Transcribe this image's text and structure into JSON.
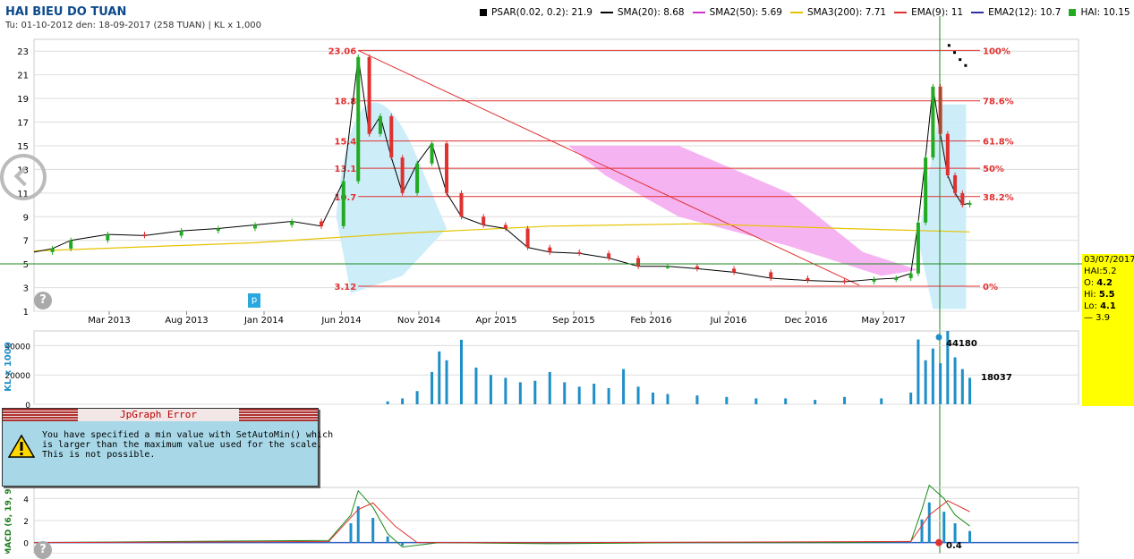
{
  "header": {
    "title": "HAI BIEU DO TUAN",
    "subtitle": "Tu: 01-10-2012 den: 18-09-2017 (258 TUAN) | KL x 1,000"
  },
  "legend": [
    {
      "label": "PSAR(0.02, 0.2): 21.9",
      "color": "#000000",
      "shape": "square"
    },
    {
      "label": "SMA(20): 8.68",
      "color": "#000000",
      "shape": "line"
    },
    {
      "label": "SMA2(50): 5.69",
      "color": "#cc33cc",
      "shape": "line"
    },
    {
      "label": "SMA3(200): 7.71",
      "color": "#e6c300",
      "shape": "line"
    },
    {
      "label": "EMA(9): 11",
      "color": "#e03030",
      "shape": "line"
    },
    {
      "label": "EMA2(12): 10.7",
      "color": "#3030a0",
      "shape": "line"
    },
    {
      "label": "HAI: 10.15",
      "color": "#22aa22",
      "shape": "square"
    }
  ],
  "info_box": {
    "date": "03/07/2017",
    "hai": "HAI:5.2",
    "o_label": "O:",
    "o_value": "4.2",
    "hi_label": "Hi:",
    "hi_value": "5.5",
    "lo_label": "Lo:",
    "lo_value": "4.1",
    "last": "— 3.9"
  },
  "error_box": {
    "title": "JpGraph Error",
    "message": "You have specified a min value with SetAutoMin() which\nis larger than the maximum value used for the scale.\nThis is not possible."
  },
  "markers": {
    "p_label": "p",
    "help_glyph": "?"
  },
  "colors": {
    "up": "#22aa22",
    "down": "#e03030",
    "cloud_blue": "#c8ecf8",
    "cloud_pink": "#f4a6f0",
    "volume_bar": "#1f8fc8",
    "fib_line": "#e03030",
    "grid": "#dddddd"
  },
  "chart_data": [
    {
      "type": "candlestick",
      "name": "price",
      "ylim": [
        1,
        24
      ],
      "yticks": [
        1,
        3,
        5,
        7,
        9,
        11,
        13,
        15,
        17,
        19,
        21,
        23
      ],
      "xticks": [
        "Mar 2013",
        "Aug 2013",
        "Jan 2014",
        "Jun 2014",
        "Nov 2014",
        "Apr 2015",
        "Sep 2015",
        "Feb 2016",
        "Jul 2016",
        "Dec 2016",
        "May 2017"
      ],
      "fibonacci": [
        {
          "label": "100%",
          "value": 23.06
        },
        {
          "label": "78.6%",
          "value": 18.8
        },
        {
          "label": "61.8%",
          "value": 15.4
        },
        {
          "label": "50%",
          "value": 13.1
        },
        {
          "label": "38.2%",
          "value": 10.7
        },
        {
          "label": "0%",
          "value": 3.12
        }
      ],
      "level_labels": [
        "23.06",
        "18.8",
        "15.4",
        "13.1",
        "10.7",
        "3.12"
      ],
      "close_series": [
        {
          "t": 0,
          "v": 6.0
        },
        {
          "t": 5,
          "v": 6.3
        },
        {
          "t": 10,
          "v": 7.0
        },
        {
          "t": 20,
          "v": 7.5
        },
        {
          "t": 30,
          "v": 7.4
        },
        {
          "t": 40,
          "v": 7.8
        },
        {
          "t": 50,
          "v": 8.0
        },
        {
          "t": 60,
          "v": 8.3
        },
        {
          "t": 70,
          "v": 8.6
        },
        {
          "t": 78,
          "v": 8.2
        },
        {
          "t": 84,
          "v": 12.0
        },
        {
          "t": 88,
          "v": 22.5
        },
        {
          "t": 91,
          "v": 16.0
        },
        {
          "t": 94,
          "v": 17.5
        },
        {
          "t": 97,
          "v": 14.0
        },
        {
          "t": 100,
          "v": 11.0
        },
        {
          "t": 104,
          "v": 13.5
        },
        {
          "t": 108,
          "v": 15.2
        },
        {
          "t": 112,
          "v": 11.0
        },
        {
          "t": 116,
          "v": 9.0
        },
        {
          "t": 122,
          "v": 8.3
        },
        {
          "t": 128,
          "v": 8.0
        },
        {
          "t": 134,
          "v": 6.4
        },
        {
          "t": 140,
          "v": 6.0
        },
        {
          "t": 148,
          "v": 5.9
        },
        {
          "t": 156,
          "v": 5.5
        },
        {
          "t": 164,
          "v": 4.8
        },
        {
          "t": 172,
          "v": 4.8
        },
        {
          "t": 180,
          "v": 4.6
        },
        {
          "t": 190,
          "v": 4.3
        },
        {
          "t": 200,
          "v": 3.8
        },
        {
          "t": 210,
          "v": 3.6
        },
        {
          "t": 220,
          "v": 3.5
        },
        {
          "t": 228,
          "v": 3.7
        },
        {
          "t": 234,
          "v": 3.8
        },
        {
          "t": 238,
          "v": 4.2
        },
        {
          "t": 240,
          "v": 8.5
        },
        {
          "t": 242,
          "v": 14.0
        },
        {
          "t": 244,
          "v": 20.0
        },
        {
          "t": 246,
          "v": 16.0
        },
        {
          "t": 248,
          "v": 12.5
        },
        {
          "t": 250,
          "v": 11.0
        },
        {
          "t": 252,
          "v": 10.0
        },
        {
          "t": 254,
          "v": 10.15
        }
      ],
      "sma200_series": [
        {
          "t": 0,
          "v": 6.1
        },
        {
          "t": 60,
          "v": 6.8
        },
        {
          "t": 100,
          "v": 7.6
        },
        {
          "t": 140,
          "v": 8.2
        },
        {
          "t": 180,
          "v": 8.4
        },
        {
          "t": 220,
          "v": 8.0
        },
        {
          "t": 254,
          "v": 7.71
        }
      ],
      "psar_recent": [
        23.6,
        23.0,
        22.4,
        21.9
      ]
    },
    {
      "type": "bar",
      "name": "volume",
      "ylabel": "KL x 1000",
      "ylim": [
        0,
        50000
      ],
      "yticks": [
        0,
        20000,
        40000
      ],
      "labels": {
        "peak": "44180",
        "last": "18037"
      },
      "values": [
        {
          "t": 96,
          "v": 2000
        },
        {
          "t": 100,
          "v": 4000
        },
        {
          "t": 104,
          "v": 9000
        },
        {
          "t": 108,
          "v": 22000
        },
        {
          "t": 110,
          "v": 36000
        },
        {
          "t": 112,
          "v": 30000
        },
        {
          "t": 116,
          "v": 44000
        },
        {
          "t": 120,
          "v": 25000
        },
        {
          "t": 124,
          "v": 20000
        },
        {
          "t": 128,
          "v": 18000
        },
        {
          "t": 132,
          "v": 15000
        },
        {
          "t": 136,
          "v": 16000
        },
        {
          "t": 140,
          "v": 22000
        },
        {
          "t": 144,
          "v": 15000
        },
        {
          "t": 148,
          "v": 12000
        },
        {
          "t": 152,
          "v": 14000
        },
        {
          "t": 156,
          "v": 11000
        },
        {
          "t": 160,
          "v": 24000
        },
        {
          "t": 164,
          "v": 12000
        },
        {
          "t": 168,
          "v": 8000
        },
        {
          "t": 172,
          "v": 7000
        },
        {
          "t": 180,
          "v": 6000
        },
        {
          "t": 188,
          "v": 5000
        },
        {
          "t": 196,
          "v": 4000
        },
        {
          "t": 204,
          "v": 4000
        },
        {
          "t": 212,
          "v": 3000
        },
        {
          "t": 220,
          "v": 5000
        },
        {
          "t": 230,
          "v": 4000
        },
        {
          "t": 238,
          "v": 8000
        },
        {
          "t": 240,
          "v": 44180
        },
        {
          "t": 242,
          "v": 30000
        },
        {
          "t": 244,
          "v": 38000
        },
        {
          "t": 246,
          "v": 28000
        },
        {
          "t": 248,
          "v": 50000
        },
        {
          "t": 250,
          "v": 32000
        },
        {
          "t": 252,
          "v": 24000
        },
        {
          "t": 254,
          "v": 18037
        }
      ]
    },
    {
      "type": "line",
      "name": "macd",
      "ylabel": "MACD (6, 19, 9)",
      "ylim": [
        -1,
        5
      ],
      "yticks": [
        0,
        2,
        4
      ],
      "labels": {
        "last": "0.4"
      },
      "macd_series": [
        {
          "t": 0,
          "v": 0.0
        },
        {
          "t": 40,
          "v": 0.1
        },
        {
          "t": 80,
          "v": 0.2
        },
        {
          "t": 86,
          "v": 2.5
        },
        {
          "t": 88,
          "v": 4.7
        },
        {
          "t": 92,
          "v": 3.2
        },
        {
          "t": 96,
          "v": 0.8
        },
        {
          "t": 100,
          "v": -0.4
        },
        {
          "t": 110,
          "v": 0.0
        },
        {
          "t": 140,
          "v": -0.1
        },
        {
          "t": 180,
          "v": 0.0
        },
        {
          "t": 220,
          "v": 0.0
        },
        {
          "t": 238,
          "v": 0.1
        },
        {
          "t": 241,
          "v": 3.0
        },
        {
          "t": 243,
          "v": 5.2
        },
        {
          "t": 247,
          "v": 4.0
        },
        {
          "t": 250,
          "v": 2.5
        },
        {
          "t": 254,
          "v": 1.5
        }
      ],
      "signal_series": [
        {
          "t": 0,
          "v": 0.0
        },
        {
          "t": 80,
          "v": 0.1
        },
        {
          "t": 88,
          "v": 3.0
        },
        {
          "t": 92,
          "v": 3.6
        },
        {
          "t": 98,
          "v": 1.5
        },
        {
          "t": 104,
          "v": 0.0
        },
        {
          "t": 140,
          "v": 0.0
        },
        {
          "t": 238,
          "v": 0.1
        },
        {
          "t": 243,
          "v": 2.5
        },
        {
          "t": 248,
          "v": 3.8
        },
        {
          "t": 254,
          "v": 2.8
        }
      ]
    }
  ]
}
